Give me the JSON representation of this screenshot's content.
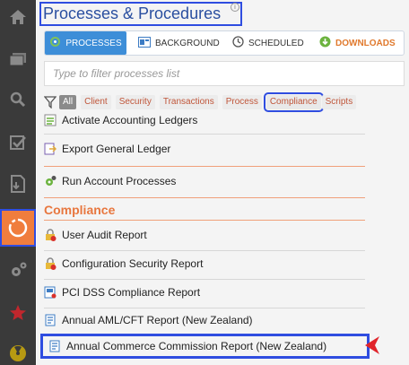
{
  "rail": {
    "items": [
      {
        "icon": "home-icon"
      },
      {
        "icon": "windows-icon"
      },
      {
        "icon": "search-icon"
      },
      {
        "icon": "checklist-icon"
      },
      {
        "icon": "document-icon"
      },
      {
        "icon": "processes-icon",
        "active": true
      },
      {
        "icon": "gears-icon"
      },
      {
        "icon": "star-icon"
      },
      {
        "icon": "radiation-icon"
      }
    ]
  },
  "header": {
    "title": "Processes & Procedures",
    "info": "i"
  },
  "tabs": [
    {
      "label": "PROCESSES",
      "icon": "processes-icon",
      "active": true
    },
    {
      "label": "BACKGROUND",
      "icon": "background-icon"
    },
    {
      "label": "SCHEDULED",
      "icon": "clock-icon"
    },
    {
      "label": "DOWNLOADS",
      "icon": "download-icon"
    }
  ],
  "filter": {
    "placeholder": "Type to filter processes list"
  },
  "categories": [
    "All",
    "Client",
    "Security",
    "Transactions",
    "Process",
    "Compliance",
    "Scripts"
  ],
  "selected_category": "Compliance",
  "list": {
    "items_before": [
      {
        "label": "Activate Accounting Ledgers",
        "icon": "ledger-icon"
      },
      {
        "label": "Export General Ledger",
        "icon": "export-icon"
      },
      {
        "label": "Run Account Processes",
        "icon": "gear-icon"
      }
    ],
    "section_title": "Compliance",
    "compliance_items": [
      {
        "label": "User Audit Report",
        "icon": "lock-warning-icon"
      },
      {
        "label": "Configuration Security Report",
        "icon": "lock-warning-icon"
      },
      {
        "label": "PCI DSS Compliance Report",
        "icon": "pci-report-icon"
      },
      {
        "label": "Annual AML/CFT Report (New Zealand)",
        "icon": "report-icon"
      },
      {
        "label": "Annual Commerce Commission Report (New Zealand)",
        "icon": "report-icon"
      }
    ]
  },
  "colors": {
    "rail_bg": "#3a3a3a",
    "accent_orange": "#f07d3d",
    "tab_active_blue": "#3d8ed8",
    "highlight_blue": "#2f4de0",
    "pointer_red": "#e0242a"
  }
}
